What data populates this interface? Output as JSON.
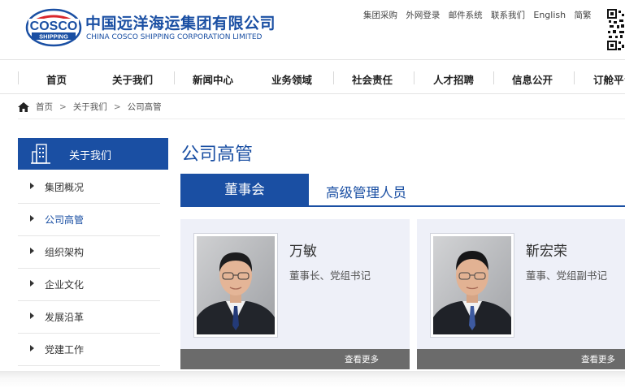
{
  "header": {
    "logo_text_top": "COSCO",
    "logo_text_bottom": "SHIPPING",
    "brand_cn": "中国远洋海运集团有限公司",
    "brand_en": "CHINA COSCO SHIPPING CORPORATION LIMITED",
    "top_links": [
      "集团采购",
      "外网登录",
      "邮件系统",
      "联系我们",
      "English",
      "简繁"
    ],
    "accent_color": "#1a4fa3"
  },
  "nav": {
    "items": [
      "首页",
      "关于我们",
      "新闻中心",
      "业务领域",
      "社会责任",
      "人才招聘",
      "信息公开",
      "订舱平台"
    ]
  },
  "breadcrumb": {
    "items": [
      "首页",
      "关于我们",
      "公司高管"
    ],
    "separator": ">"
  },
  "sidebar": {
    "title": "关于我们",
    "items": [
      {
        "label": "集团概况",
        "active": false
      },
      {
        "label": "公司高管",
        "active": true
      },
      {
        "label": "组织架构",
        "active": false
      },
      {
        "label": "企业文化",
        "active": false
      },
      {
        "label": "发展沿革",
        "active": false
      },
      {
        "label": "党建工作",
        "active": false
      }
    ]
  },
  "main": {
    "title": "公司高管",
    "tabs": [
      {
        "label": "董事会",
        "active": true
      },
      {
        "label": "高级管理人员",
        "active": false
      }
    ],
    "cards": [
      {
        "name": "万敏",
        "role": "董事长、党组书记",
        "more_label": "查看更多",
        "tie_color": "#233a78"
      },
      {
        "name": "靳宏荣",
        "role": "董事、党组副书记",
        "more_label": "查看更多",
        "tie_color": "#3d5aa0"
      }
    ]
  }
}
